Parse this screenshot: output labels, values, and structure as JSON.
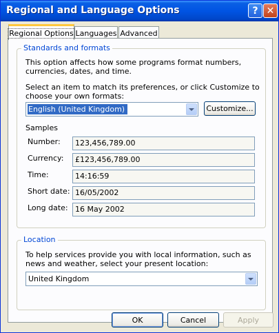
{
  "window": {
    "title": "Regional and Language Options",
    "help_glyph": "?",
    "close_glyph": "✕"
  },
  "tabs": [
    {
      "label": "Regional Options",
      "active": true
    },
    {
      "label": "Languages",
      "active": false
    },
    {
      "label": "Advanced",
      "active": false
    }
  ],
  "standards": {
    "legend": "Standards and formats",
    "intro": "This option affects how some programs format numbers, currencies, dates, and time.",
    "select_prompt": "Select an item to match its preferences, or click Customize to choose your own formats:",
    "selected_locale": "English (United Kingdom)",
    "customize_label": "Customize...",
    "samples_heading": "Samples",
    "samples": [
      {
        "label": "Number:",
        "value": "123,456,789.00"
      },
      {
        "label": "Currency:",
        "value": "£123,456,789.00"
      },
      {
        "label": "Time:",
        "value": "14:16:59"
      },
      {
        "label": "Short date:",
        "value": "16/05/2002"
      },
      {
        "label": "Long date:",
        "value": "16 May 2002"
      }
    ]
  },
  "location": {
    "legend": "Location",
    "intro": "To help services provide you with local information, such as news and weather, select your present location:",
    "selected": "United Kingdom"
  },
  "footer": {
    "ok_label": "OK",
    "cancel_label": "Cancel",
    "apply_label": "Apply"
  },
  "colors": {
    "title_bar": "#0054e3",
    "group_legend": "#0046d5",
    "selection": "#316ac5",
    "active_tab_accent": "#ffc73c"
  }
}
